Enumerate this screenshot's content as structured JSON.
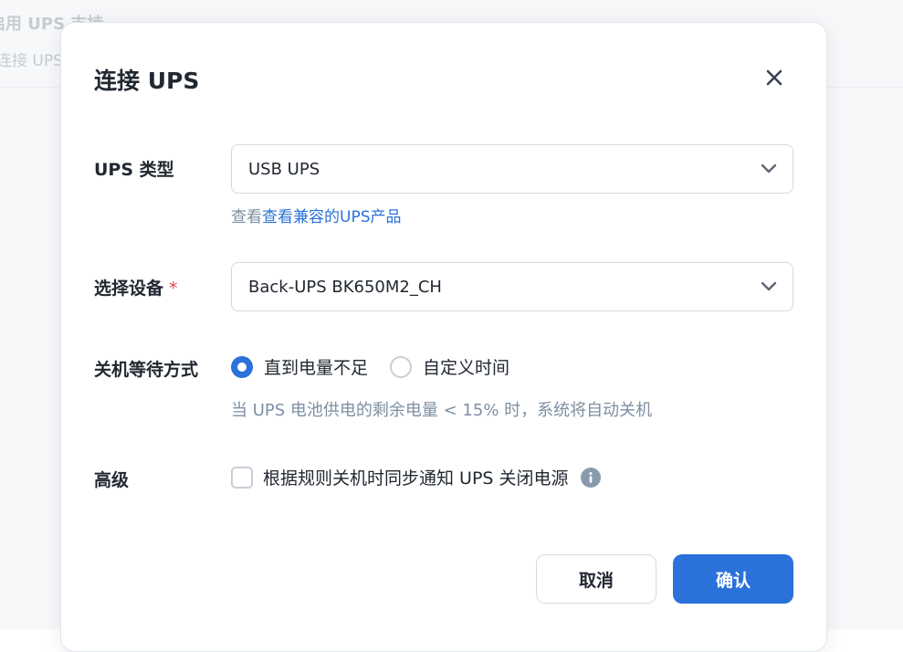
{
  "background": {
    "title": "启用 UPS 支持",
    "subtitle": "连接 UPS"
  },
  "dialog": {
    "title": "连接 UPS",
    "close_icon": "close-icon"
  },
  "form": {
    "ups_type": {
      "label": "UPS 类型",
      "value": "USB UPS",
      "link_prefix": "查看",
      "link_text": "查看兼容的UPS产品"
    },
    "device": {
      "label": "选择设备",
      "required_mark": "*",
      "value": "Back-UPS BK650M2_CH"
    },
    "shutdown_wait": {
      "label": "关机等待方式",
      "options": [
        "直到电量不足",
        "自定义时间"
      ],
      "selected": "直到电量不足",
      "hint": "当 UPS 电池供电的剩余电量 < 15% 时，系统将自动关机"
    },
    "advanced": {
      "label": "高级",
      "checkbox_label": "根据规则关机时同步通知 UPS 关闭电源",
      "checked": false,
      "info_icon": "info-icon"
    }
  },
  "buttons": {
    "cancel": "取消",
    "confirm": "确认"
  },
  "colors": {
    "accent": "#2a72d9",
    "required": "#e5484d",
    "hint": "#7e8fa3"
  }
}
